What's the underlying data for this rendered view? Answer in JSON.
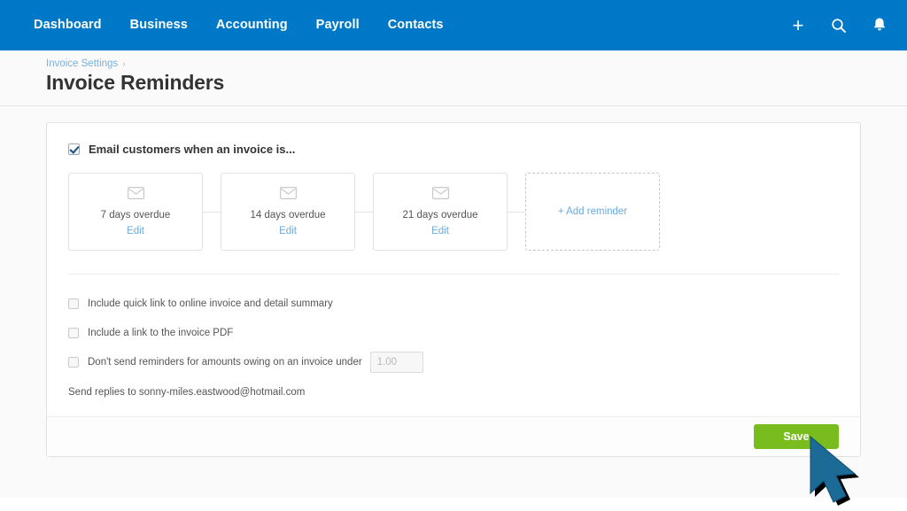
{
  "nav": {
    "items": [
      {
        "label": "Dashboard"
      },
      {
        "label": "Business"
      },
      {
        "label": "Accounting"
      },
      {
        "label": "Payroll"
      },
      {
        "label": "Contacts"
      }
    ],
    "actions": [
      {
        "icon": "plus-icon",
        "glyph": "+"
      },
      {
        "icon": "search-icon"
      },
      {
        "icon": "bell-icon"
      }
    ],
    "background_color": "#0078c8"
  },
  "breadcrumb": {
    "link": "Invoice Settings",
    "separator": "›"
  },
  "page_title": "Invoice Reminders",
  "master_toggle": {
    "label": "Email customers when an invoice is...",
    "checked": true
  },
  "reminders": [
    {
      "label": "7 days overdue",
      "edit_label": "Edit",
      "icon": "envelope-icon"
    },
    {
      "label": "14 days overdue",
      "edit_label": "Edit",
      "icon": "envelope-icon"
    },
    {
      "label": "21 days overdue",
      "edit_label": "Edit",
      "icon": "envelope-icon"
    }
  ],
  "add_reminder": {
    "label": "+ Add reminder"
  },
  "options": [
    {
      "label": "Include quick link to online invoice and detail summary",
      "checked": false
    },
    {
      "label": "Include a link to the invoice PDF",
      "checked": false
    },
    {
      "label": "Don't send reminders for amounts owing on an invoice under",
      "checked": false,
      "amount_placeholder": "1.00",
      "amount_value": ""
    }
  ],
  "reply_line": "Send replies to sonny-miles.eastwood@hotmail.com",
  "footer": {
    "save_label": "Save",
    "save_color": "#78bd1d"
  },
  "cursor": {
    "name": "mouse-pointer",
    "color": "#1b6b96"
  }
}
